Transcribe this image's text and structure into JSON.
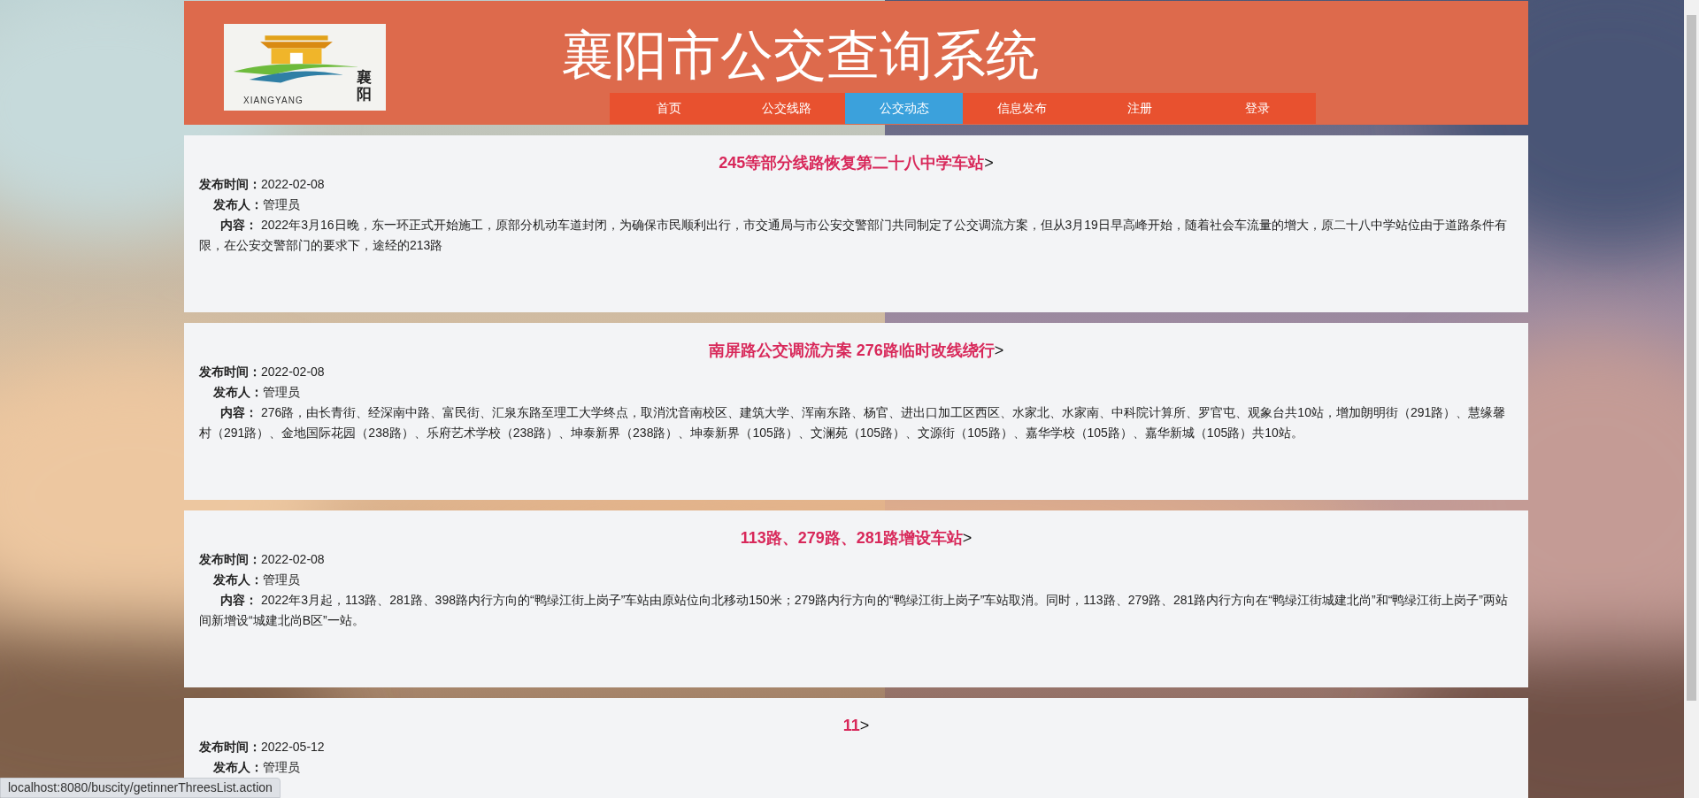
{
  "header": {
    "logo": {
      "chinese": "襄阳",
      "latin": "XIANGYANG"
    },
    "title": "襄阳市公交查询系统"
  },
  "nav": [
    {
      "label": "首页",
      "selected": false
    },
    {
      "label": "公交线路",
      "selected": false
    },
    {
      "label": "公交动态",
      "selected": true
    },
    {
      "label": "信息发布",
      "selected": false
    },
    {
      "label": "注册",
      "selected": false
    },
    {
      "label": "登录",
      "selected": false
    }
  ],
  "articles": [
    {
      "title": "245等部分线路恢复第二十八中学车站",
      "arrow": ">",
      "date_label": "发布时间：",
      "date": "2022-02-08",
      "publisher_label": "发布人：",
      "publisher": "管理员",
      "content_label": "内容：",
      "content": "2022年3月16日晚，东一环正式开始施工，原部分机动车道封闭，为确保市民顺利出行，市交通局与市公安交警部门共同制定了公交调流方案，但从3月19日早高峰开始，随着社会车流量的增大，原二十八中学站位由于道路条件有限，在公安交警部门的要求下，途经的213路"
    },
    {
      "title": "南屏路公交调流方案 276路临时改线绕行",
      "arrow": ">",
      "date_label": "发布时间：",
      "date": "2022-02-08",
      "publisher_label": "发布人：",
      "publisher": "管理员",
      "content_label": "内容：",
      "content": "276路，由长青街、经深南中路、富民街、汇泉东路至理工大学终点，取消沈音南校区、建筑大学、浑南东路、杨官、进出口加工区西区、水家北、水家南、中科院计算所、罗官屯、观象台共10站，增加朗明街（291路）、慧缘馨村（291路）、金地国际花园（238路）、乐府艺术学校（238路）、坤泰新界（238路）、坤泰新界（105路）、文澜苑（105路）、文源街（105路）、嘉华学校（105路）、嘉华新城（105路）共10站。"
    },
    {
      "title": "113路、279路、281路增设车站",
      "arrow": ">",
      "date_label": "发布时间：",
      "date": "2022-02-08",
      "publisher_label": "发布人：",
      "publisher": "管理员",
      "content_label": "内容：",
      "content": "2022年3月起，113路、281路、398路内行方向的“鸭绿江街上岗子”车站由原站位向北移动150米；279路内行方向的“鸭绿江街上岗子”车站取消。同时，113路、279路、281路内行方向在“鸭绿江街城建北尚”和“鸭绿江街上岗子”两站间新增设“城建北尚B区”一站。"
    },
    {
      "title": "11",
      "arrow": ">",
      "date_label": "发布时间：",
      "date": "2022-05-12",
      "publisher_label": "发布人：",
      "publisher": "管理员"
    }
  ],
  "status_bar": "localhost:8080/buscity/getinnerThreesList.action"
}
